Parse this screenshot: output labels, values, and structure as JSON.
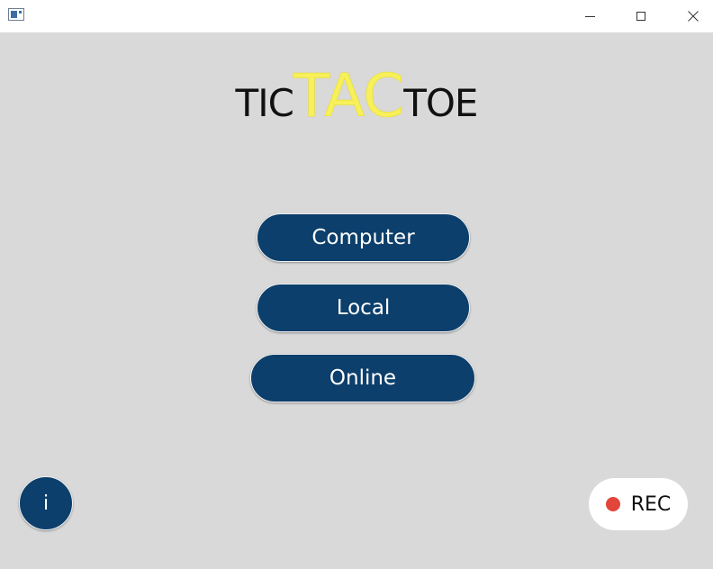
{
  "titlebar": {
    "controls": [
      "minimize-icon",
      "maximize-icon",
      "close-icon"
    ]
  },
  "title": {
    "part1": "TIC",
    "part2": "TAC",
    "part3": "TOE"
  },
  "menu": {
    "computer_label": "Computer",
    "local_label": "Local",
    "online_label": "Online"
  },
  "info": {
    "label": "i"
  },
  "rec": {
    "label": "REC"
  },
  "colors": {
    "background": "#d9d9d9",
    "button": "#0c3f6b",
    "title_highlight": "#f7f05a",
    "rec_dot": "#e2463a"
  }
}
